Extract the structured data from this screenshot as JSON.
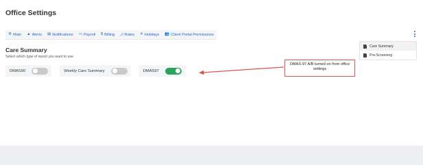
{
  "page": {
    "title": "Office Settings"
  },
  "tabs": [
    {
      "label": "Main",
      "icon": "gear-icon",
      "glyph": "⚙"
    },
    {
      "label": "Alerts",
      "icon": "bell-icon",
      "glyph": "▲"
    },
    {
      "label": "Notifications",
      "icon": "document-icon",
      "glyph": "▤"
    },
    {
      "label": "Payroll",
      "icon": "card-icon",
      "glyph": "▭"
    },
    {
      "label": "Billing",
      "icon": "dollar-icon",
      "glyph": "$"
    },
    {
      "label": "Rates",
      "icon": "line-chart-icon",
      "glyph": "◿"
    },
    {
      "label": "Holidays",
      "icon": "close-icon",
      "glyph": "✕"
    },
    {
      "label": "Client Portal Permissions",
      "icon": "users-icon",
      "glyph": "👥"
    }
  ],
  "side_menu": {
    "items": [
      {
        "label": "Care Summary",
        "active": true
      },
      {
        "label": "Pre-Screening",
        "active": false
      }
    ]
  },
  "care_summary": {
    "title": "Care Summary",
    "subtitle": "Select which type of report you want to use.",
    "reports": [
      {
        "label": "DMAS90",
        "enabled": false
      },
      {
        "label": "Weekly Care Summary",
        "enabled": false
      },
      {
        "label": "DMAS97",
        "enabled": true
      }
    ]
  },
  "annotation": {
    "line1": "DMAS-97 A/B turned on from office",
    "line2": "settings"
  },
  "colors": {
    "link": "#2d66c4",
    "toggle_on": "#2ea35e",
    "toggle_off": "#c9c9c9",
    "annotation": "#d9534f"
  }
}
